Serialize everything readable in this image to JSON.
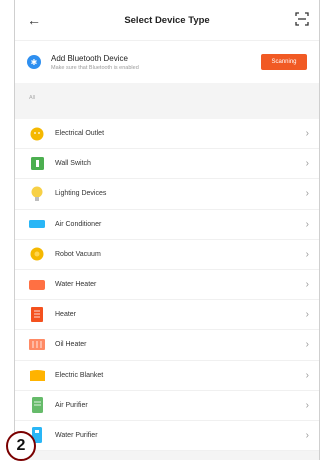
{
  "header": {
    "title": "Select Device Type",
    "back_icon": "arrow-left-icon",
    "scan_icon": "scan-icon"
  },
  "bluetooth": {
    "title": "Add Bluetooth Device",
    "subtitle": "Make sure that Bluetooth is enabled",
    "button_label": "Scanning",
    "accent": "#f15a24",
    "icon_color": "#2e8ff0"
  },
  "section_label": "All",
  "devices": [
    {
      "label": "Electrical Outlet",
      "icon": "outlet-icon",
      "color": "#f5b800"
    },
    {
      "label": "Wall Switch",
      "icon": "switch-icon",
      "color": "#4caf50"
    },
    {
      "label": "Lighting Devices",
      "icon": "bulb-icon",
      "color": "#f7d046"
    },
    {
      "label": "Air Conditioner",
      "icon": "ac-icon",
      "color": "#29b6f6"
    },
    {
      "label": "Robot Vacuum",
      "icon": "vacuum-icon",
      "color": "#f5b800"
    },
    {
      "label": "Water Heater",
      "icon": "heater-icon",
      "color": "#ff7043"
    },
    {
      "label": "Heater",
      "icon": "heater-panel-icon",
      "color": "#f4511e"
    },
    {
      "label": "Oil Heater",
      "icon": "oil-heater-icon",
      "color": "#ff8a65"
    },
    {
      "label": "Electric Blanket",
      "icon": "blanket-icon",
      "color": "#ffb300"
    },
    {
      "label": "Air Purifier",
      "icon": "purifier-icon",
      "color": "#66bb6a"
    },
    {
      "label": "Water Purifier",
      "icon": "water-purifier-icon",
      "color": "#29b6f6"
    }
  ],
  "step_badge": "2"
}
